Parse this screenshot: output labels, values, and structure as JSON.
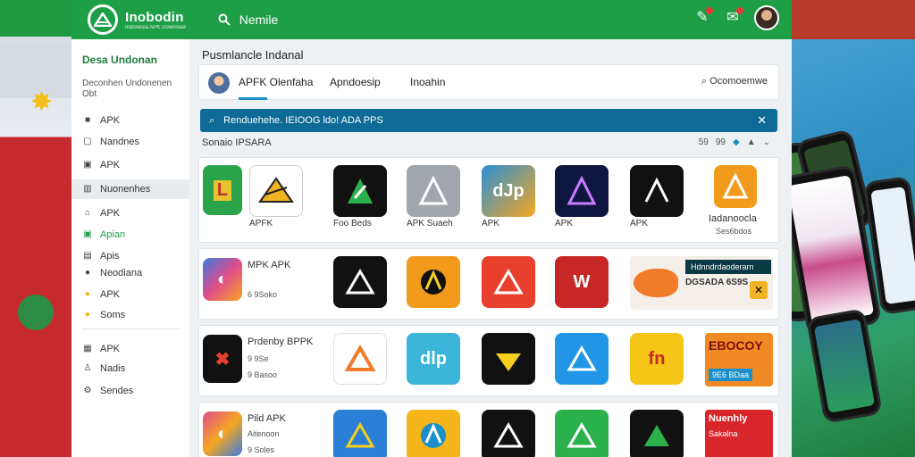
{
  "brand": {
    "name": "Inobodin",
    "tagline": "Indonesia APK Download",
    "accent": "#1e9f47"
  },
  "topbar": {
    "search_label": "Nemile"
  },
  "sidebar": {
    "title": "Desa Undonan",
    "subtitle": "Deconhen Undonenen Obt",
    "items": [
      {
        "label": "APK",
        "icon": "briefcase-icon"
      },
      {
        "label": "Nandnes",
        "icon": "chat-icon"
      },
      {
        "label": "APK",
        "icon": "document-icon"
      },
      {
        "label": "Nuonenhes",
        "icon": "building-icon"
      },
      {
        "label": "APK",
        "icon": "lock-icon"
      },
      {
        "label": "Apian",
        "icon": "check-icon"
      },
      {
        "label": "Apis",
        "icon": "clipboard-icon"
      },
      {
        "label": "Neodiana",
        "icon": "user-icon"
      },
      {
        "label": "APK",
        "icon": "coin-icon"
      },
      {
        "label": "Soms",
        "icon": "coin-icon"
      },
      {
        "label": "APK",
        "icon": "grid-icon"
      },
      {
        "label": "Nadis",
        "icon": "people-icon"
      },
      {
        "label": "Sendes",
        "icon": "chart-icon"
      }
    ]
  },
  "main": {
    "page_title": "Pusmlancle Indanal",
    "tabs": [
      "APFK Olenfaha",
      "Apndoesip",
      "Inoahin"
    ],
    "tab_right": "Ocomoemwe",
    "banner": "Renduehehe. IEIOOG ldo! ADA PPS",
    "section_title": "Sonaio IPSARA",
    "section_controls": [
      "59",
      "99"
    ],
    "rows": [
      {
        "labels": [
          "APFK",
          "Foo Beds",
          "APK Suaeh",
          "APK",
          "APK",
          "APK"
        ],
        "promo_title": "Iadanoocla",
        "promo_sub": "Ses6bdos"
      },
      {
        "title": "MPK APK",
        "sub": "6 9Soko",
        "promo_title": "Hdnndrdaoderarn",
        "promo_sub": "DGSADA 6S9S"
      },
      {
        "title": "Prdenby BPPK",
        "sub": "9 9Se",
        "sub2": "9 Basoo",
        "promo_title": "EBOCOY",
        "promo_sub": "9E6 BDaa"
      },
      {
        "title": "Pild APK",
        "sub": "Aitenoon",
        "sub2": "9 Soles",
        "promo_title": "Nuenhly",
        "promo_sub": "Sakalna"
      }
    ]
  }
}
